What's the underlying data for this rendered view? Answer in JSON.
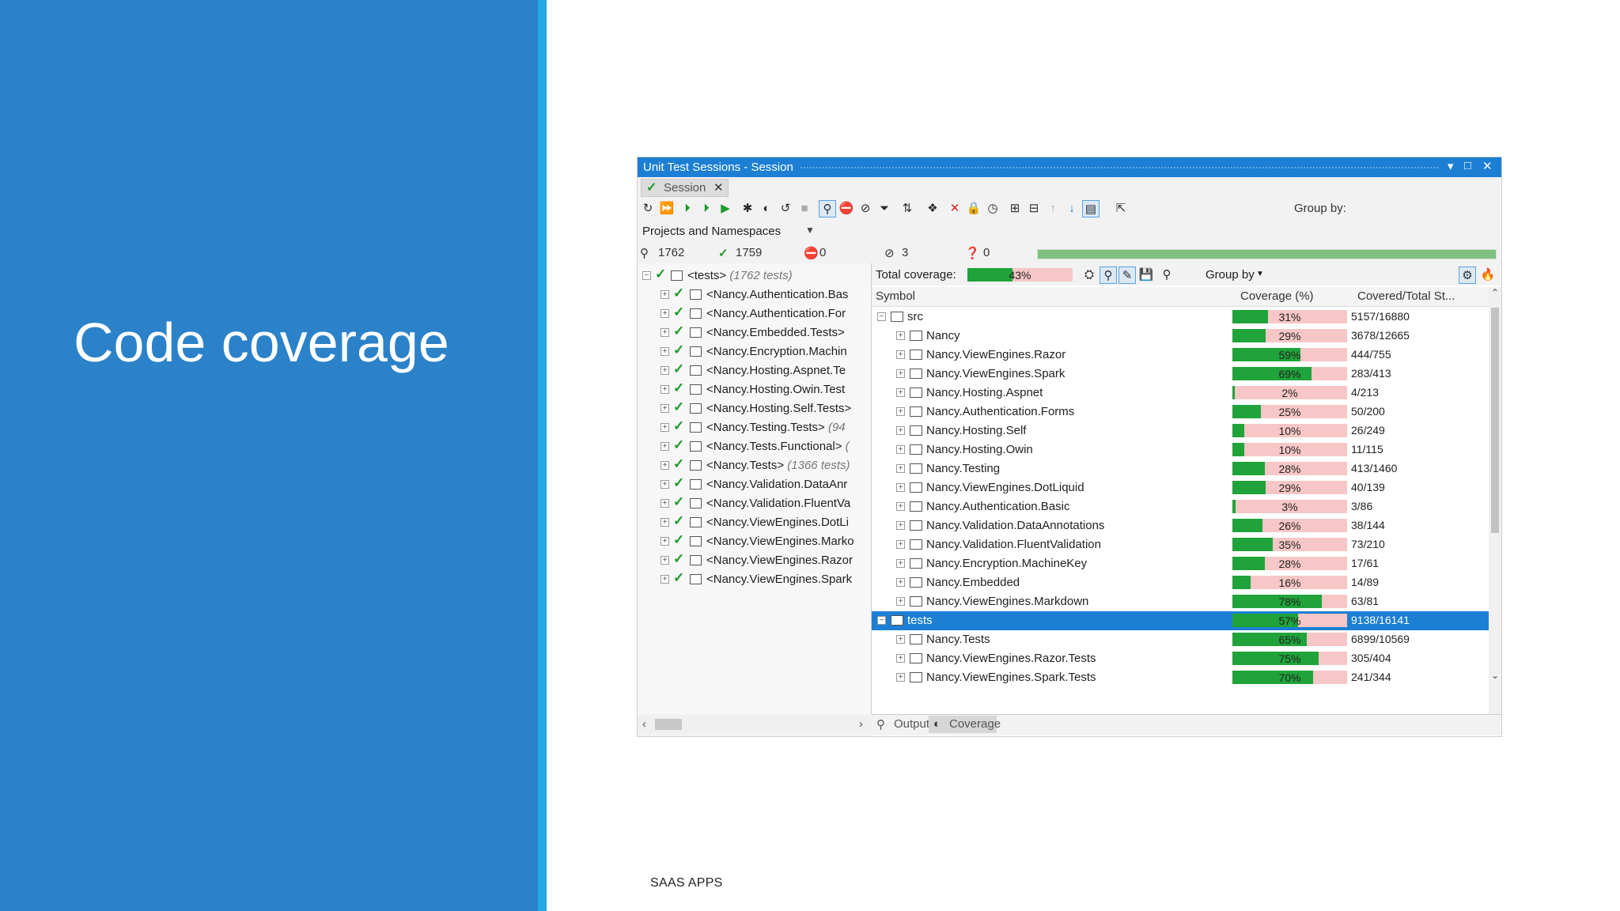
{
  "slide": {
    "title": "Code coverage",
    "footer": "SAAS APPS"
  },
  "colors": {
    "slide_blue": "#2b82c9",
    "stripe": "#25a8e4",
    "title_bar": "#1c7fd4",
    "covered": "#1fa33a",
    "uncovered": "#f7c6c6"
  },
  "window": {
    "title": "Unit Test Sessions - Session",
    "controls": [
      "▾",
      "□",
      "✕"
    ],
    "tab": {
      "label": "Session",
      "close": "✕"
    },
    "toolbar": {
      "group_by": "Group by:"
    },
    "dropdown": "Projects and Namespaces",
    "stats": {
      "total": "1762",
      "passed": "1759",
      "failed": "0",
      "ignored": "3",
      "unknown": "0"
    },
    "test_progress_fraction": 1.0
  },
  "tree": {
    "root": {
      "label": "<tests>",
      "count": "(1762 tests)"
    },
    "items": [
      {
        "label": "<Nancy.Authentication.Bas",
        "count": ""
      },
      {
        "label": "<Nancy.Authentication.For",
        "count": ""
      },
      {
        "label": "<Nancy.Embedded.Tests>",
        "count": ""
      },
      {
        "label": "<Nancy.Encryption.Machin",
        "count": ""
      },
      {
        "label": "<Nancy.Hosting.Aspnet.Te",
        "count": ""
      },
      {
        "label": "<Nancy.Hosting.Owin.Test",
        "count": ""
      },
      {
        "label": "<Nancy.Hosting.Self.Tests>",
        "count": ""
      },
      {
        "label": "<Nancy.Testing.Tests>",
        "count": "(94"
      },
      {
        "label": "<Nancy.Tests.Functional>",
        "count": "("
      },
      {
        "label": "<Nancy.Tests>",
        "count": "(1366 tests)"
      },
      {
        "label": "<Nancy.Validation.DataAnr",
        "count": ""
      },
      {
        "label": "<Nancy.Validation.FluentVa",
        "count": ""
      },
      {
        "label": "<Nancy.ViewEngines.DotLi",
        "count": ""
      },
      {
        "label": "<Nancy.ViewEngines.Marko",
        "count": ""
      },
      {
        "label": "<Nancy.ViewEngines.Razor",
        "count": ""
      },
      {
        "label": "<Nancy.ViewEngines.Spark",
        "count": ""
      }
    ]
  },
  "coverage": {
    "total_label": "Total coverage:",
    "total_pct": "43%",
    "total_value": 43,
    "group_by": "Group by",
    "columns": {
      "symbol": "Symbol",
      "coverage": "Coverage (%)",
      "covered": "Covered/Total St..."
    },
    "rows": [
      {
        "name": "src",
        "level": 0,
        "pct": "31%",
        "value": 31,
        "covered": "5157/16880",
        "selected": false
      },
      {
        "name": "Nancy",
        "level": 1,
        "pct": "29%",
        "value": 29,
        "covered": "3678/12665",
        "selected": false
      },
      {
        "name": "Nancy.ViewEngines.Razor",
        "level": 1,
        "pct": "59%",
        "value": 59,
        "covered": "444/755",
        "selected": false
      },
      {
        "name": "Nancy.ViewEngines.Spark",
        "level": 1,
        "pct": "69%",
        "value": 69,
        "covered": "283/413",
        "selected": false
      },
      {
        "name": "Nancy.Hosting.Aspnet",
        "level": 1,
        "pct": "2%",
        "value": 2,
        "covered": "4/213",
        "selected": false
      },
      {
        "name": "Nancy.Authentication.Forms",
        "level": 1,
        "pct": "25%",
        "value": 25,
        "covered": "50/200",
        "selected": false
      },
      {
        "name": "Nancy.Hosting.Self",
        "level": 1,
        "pct": "10%",
        "value": 10,
        "covered": "26/249",
        "selected": false
      },
      {
        "name": "Nancy.Hosting.Owin",
        "level": 1,
        "pct": "10%",
        "value": 10,
        "covered": "11/115",
        "selected": false
      },
      {
        "name": "Nancy.Testing",
        "level": 1,
        "pct": "28%",
        "value": 28,
        "covered": "413/1460",
        "selected": false
      },
      {
        "name": "Nancy.ViewEngines.DotLiquid",
        "level": 1,
        "pct": "29%",
        "value": 29,
        "covered": "40/139",
        "selected": false
      },
      {
        "name": "Nancy.Authentication.Basic",
        "level": 1,
        "pct": "3%",
        "value": 3,
        "covered": "3/86",
        "selected": false
      },
      {
        "name": "Nancy.Validation.DataAnnotations",
        "level": 1,
        "pct": "26%",
        "value": 26,
        "covered": "38/144",
        "selected": false
      },
      {
        "name": "Nancy.Validation.FluentValidation",
        "level": 1,
        "pct": "35%",
        "value": 35,
        "covered": "73/210",
        "selected": false
      },
      {
        "name": "Nancy.Encryption.MachineKey",
        "level": 1,
        "pct": "28%",
        "value": 28,
        "covered": "17/61",
        "selected": false
      },
      {
        "name": "Nancy.Embedded",
        "level": 1,
        "pct": "16%",
        "value": 16,
        "covered": "14/89",
        "selected": false
      },
      {
        "name": "Nancy.ViewEngines.Markdown",
        "level": 1,
        "pct": "78%",
        "value": 78,
        "covered": "63/81",
        "selected": false
      },
      {
        "name": "tests",
        "level": 0,
        "pct": "57%",
        "value": 57,
        "covered": "9138/16141",
        "selected": true
      },
      {
        "name": "Nancy.Tests",
        "level": 1,
        "pct": "65%",
        "value": 65,
        "covered": "6899/10569",
        "selected": false
      },
      {
        "name": "Nancy.ViewEngines.Razor.Tests",
        "level": 1,
        "pct": "75%",
        "value": 75,
        "covered": "305/404",
        "selected": false
      },
      {
        "name": "Nancy.ViewEngines.Spark.Tests",
        "level": 1,
        "pct": "70%",
        "value": 70,
        "covered": "241/344",
        "selected": false
      }
    ]
  },
  "bottom_tabs": [
    "Output",
    "Coverage"
  ]
}
